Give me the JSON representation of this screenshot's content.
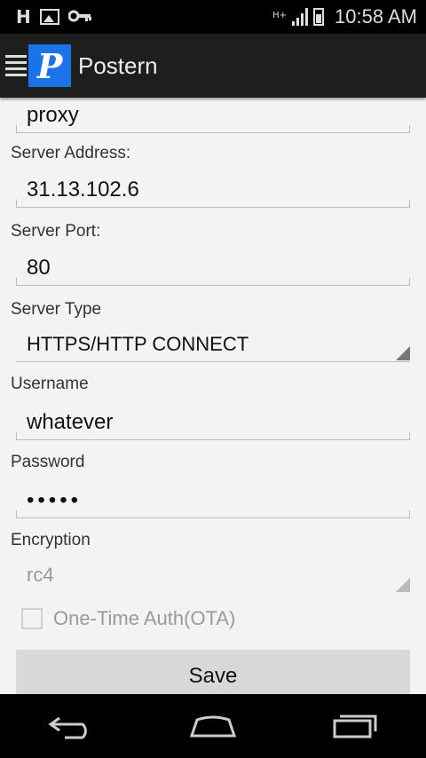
{
  "status_bar": {
    "indicator_h": "H",
    "network_type": "H+",
    "time": "10:58 AM",
    "icons": [
      "image-icon",
      "key-icon",
      "signal-icon",
      "battery-icon"
    ]
  },
  "action_bar": {
    "logo_letter": "P",
    "title": "Postern",
    "logo_color": "#1a73e8"
  },
  "form": {
    "name_value": "proxy",
    "server_address_label": "Server Address:",
    "server_address_value": "31.13.102.6",
    "server_port_label": "Server Port:",
    "server_port_value": "80",
    "server_type_label": "Server Type",
    "server_type_value": "HTTPS/HTTP CONNECT",
    "username_label": "Username",
    "username_value": "whatever",
    "password_label": "Password",
    "password_value": "•••••",
    "encryption_label": "Encryption",
    "encryption_value": "rc4",
    "ota_label": "One-Time Auth(OTA)",
    "ota_checked": false,
    "save_label": "Save"
  },
  "nav_bar": {
    "icons": [
      "back-icon",
      "home-icon",
      "recent-apps-icon"
    ]
  }
}
